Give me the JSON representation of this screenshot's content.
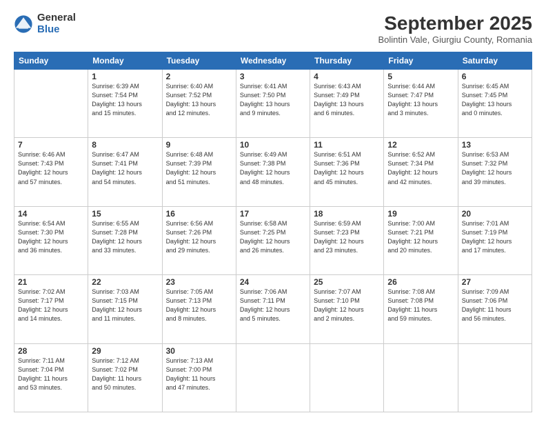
{
  "logo": {
    "general": "General",
    "blue": "Blue"
  },
  "title": "September 2025",
  "subtitle": "Bolintin Vale, Giurgiu County, Romania",
  "days": [
    "Sunday",
    "Monday",
    "Tuesday",
    "Wednesday",
    "Thursday",
    "Friday",
    "Saturday"
  ],
  "weeks": [
    [
      {
        "day": "",
        "info": ""
      },
      {
        "day": "1",
        "info": "Sunrise: 6:39 AM\nSunset: 7:54 PM\nDaylight: 13 hours\nand 15 minutes."
      },
      {
        "day": "2",
        "info": "Sunrise: 6:40 AM\nSunset: 7:52 PM\nDaylight: 13 hours\nand 12 minutes."
      },
      {
        "day": "3",
        "info": "Sunrise: 6:41 AM\nSunset: 7:50 PM\nDaylight: 13 hours\nand 9 minutes."
      },
      {
        "day": "4",
        "info": "Sunrise: 6:43 AM\nSunset: 7:49 PM\nDaylight: 13 hours\nand 6 minutes."
      },
      {
        "day": "5",
        "info": "Sunrise: 6:44 AM\nSunset: 7:47 PM\nDaylight: 13 hours\nand 3 minutes."
      },
      {
        "day": "6",
        "info": "Sunrise: 6:45 AM\nSunset: 7:45 PM\nDaylight: 13 hours\nand 0 minutes."
      }
    ],
    [
      {
        "day": "7",
        "info": "Sunrise: 6:46 AM\nSunset: 7:43 PM\nDaylight: 12 hours\nand 57 minutes."
      },
      {
        "day": "8",
        "info": "Sunrise: 6:47 AM\nSunset: 7:41 PM\nDaylight: 12 hours\nand 54 minutes."
      },
      {
        "day": "9",
        "info": "Sunrise: 6:48 AM\nSunset: 7:39 PM\nDaylight: 12 hours\nand 51 minutes."
      },
      {
        "day": "10",
        "info": "Sunrise: 6:49 AM\nSunset: 7:38 PM\nDaylight: 12 hours\nand 48 minutes."
      },
      {
        "day": "11",
        "info": "Sunrise: 6:51 AM\nSunset: 7:36 PM\nDaylight: 12 hours\nand 45 minutes."
      },
      {
        "day": "12",
        "info": "Sunrise: 6:52 AM\nSunset: 7:34 PM\nDaylight: 12 hours\nand 42 minutes."
      },
      {
        "day": "13",
        "info": "Sunrise: 6:53 AM\nSunset: 7:32 PM\nDaylight: 12 hours\nand 39 minutes."
      }
    ],
    [
      {
        "day": "14",
        "info": "Sunrise: 6:54 AM\nSunset: 7:30 PM\nDaylight: 12 hours\nand 36 minutes."
      },
      {
        "day": "15",
        "info": "Sunrise: 6:55 AM\nSunset: 7:28 PM\nDaylight: 12 hours\nand 33 minutes."
      },
      {
        "day": "16",
        "info": "Sunrise: 6:56 AM\nSunset: 7:26 PM\nDaylight: 12 hours\nand 29 minutes."
      },
      {
        "day": "17",
        "info": "Sunrise: 6:58 AM\nSunset: 7:25 PM\nDaylight: 12 hours\nand 26 minutes."
      },
      {
        "day": "18",
        "info": "Sunrise: 6:59 AM\nSunset: 7:23 PM\nDaylight: 12 hours\nand 23 minutes."
      },
      {
        "day": "19",
        "info": "Sunrise: 7:00 AM\nSunset: 7:21 PM\nDaylight: 12 hours\nand 20 minutes."
      },
      {
        "day": "20",
        "info": "Sunrise: 7:01 AM\nSunset: 7:19 PM\nDaylight: 12 hours\nand 17 minutes."
      }
    ],
    [
      {
        "day": "21",
        "info": "Sunrise: 7:02 AM\nSunset: 7:17 PM\nDaylight: 12 hours\nand 14 minutes."
      },
      {
        "day": "22",
        "info": "Sunrise: 7:03 AM\nSunset: 7:15 PM\nDaylight: 12 hours\nand 11 minutes."
      },
      {
        "day": "23",
        "info": "Sunrise: 7:05 AM\nSunset: 7:13 PM\nDaylight: 12 hours\nand 8 minutes."
      },
      {
        "day": "24",
        "info": "Sunrise: 7:06 AM\nSunset: 7:11 PM\nDaylight: 12 hours\nand 5 minutes."
      },
      {
        "day": "25",
        "info": "Sunrise: 7:07 AM\nSunset: 7:10 PM\nDaylight: 12 hours\nand 2 minutes."
      },
      {
        "day": "26",
        "info": "Sunrise: 7:08 AM\nSunset: 7:08 PM\nDaylight: 11 hours\nand 59 minutes."
      },
      {
        "day": "27",
        "info": "Sunrise: 7:09 AM\nSunset: 7:06 PM\nDaylight: 11 hours\nand 56 minutes."
      }
    ],
    [
      {
        "day": "28",
        "info": "Sunrise: 7:11 AM\nSunset: 7:04 PM\nDaylight: 11 hours\nand 53 minutes."
      },
      {
        "day": "29",
        "info": "Sunrise: 7:12 AM\nSunset: 7:02 PM\nDaylight: 11 hours\nand 50 minutes."
      },
      {
        "day": "30",
        "info": "Sunrise: 7:13 AM\nSunset: 7:00 PM\nDaylight: 11 hours\nand 47 minutes."
      },
      {
        "day": "",
        "info": ""
      },
      {
        "day": "",
        "info": ""
      },
      {
        "day": "",
        "info": ""
      },
      {
        "day": "",
        "info": ""
      }
    ]
  ]
}
